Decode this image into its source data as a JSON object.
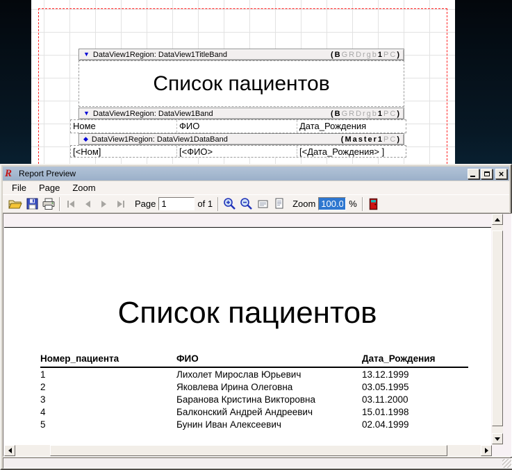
{
  "designer": {
    "bands": [
      {
        "icon_glyph": "▼",
        "caption": "DataView1Region: DataView1TitleBand",
        "flag_open": "(B",
        "flag_gray1": "GRDrgb",
        "flag_num": "1",
        "flag_gray2": "PC",
        "flag_close": ")"
      },
      {
        "icon_glyph": "▼",
        "caption": "DataView1Region: DataView1Band",
        "flag_open": "(B",
        "flag_gray1": "GRDrgb",
        "flag_num": "1",
        "flag_gray2": "PC",
        "flag_close": ")"
      },
      {
        "icon_glyph": "◆",
        "caption": "DataView1Region: DataView1DataBand",
        "flag_open": "(Master",
        "flag_gray1": "",
        "flag_num": "1",
        "flag_gray2": "PC",
        "flag_close": ")"
      }
    ],
    "title_region_text": "Список пациентов",
    "header_row": {
      "col1": "Номе",
      "col2": "ФИО",
      "col3": "Дата_Рождения"
    },
    "data_row": {
      "col1": "[<Ном]",
      "col2": "[<ФИО>",
      "col3": "[<Дата_Рождения> ]"
    }
  },
  "preview": {
    "window_title": "Report Preview",
    "window_buttons": {
      "close_glyph": "×"
    },
    "menu": {
      "items": [
        {
          "label": "File"
        },
        {
          "label": "Page"
        },
        {
          "label": "Zoom"
        }
      ]
    },
    "toolbar": {
      "page_label": "Page",
      "page_value": "1",
      "of_label": "of 1",
      "zoom_label": "Zoom",
      "zoom_value": "100.0",
      "percent_label": "%"
    },
    "report": {
      "title": "Список пациентов",
      "columns": {
        "c1": "Номер_пациента",
        "c2": "ФИО",
        "c3": "Дата_Рождения"
      },
      "rows": [
        {
          "num": "1",
          "name": "Лихолет Мирослав Юрьевич",
          "date": "13.12.1999"
        },
        {
          "num": "2",
          "name": "Яковлева Ирина Олеговна",
          "date": "03.05.1995"
        },
        {
          "num": "3",
          "name": "Баранова Кристина Викторовна",
          "date": "03.11.2000"
        },
        {
          "num": "4",
          "name": "Балконский Андрей Андреевич",
          "date": "15.01.1998"
        },
        {
          "num": "5",
          "name": "Бунин Иван Алексеевич",
          "date": "02.04.1999"
        }
      ]
    }
  },
  "colors": {
    "titlebar": "#A9BCD3",
    "selection_blue": "#2E77D0",
    "band_icon_blue": "#0000D6",
    "margin_red": "#FF2020",
    "desktop_top": "#04080D",
    "desktop_bottom": "#1F78AD"
  }
}
